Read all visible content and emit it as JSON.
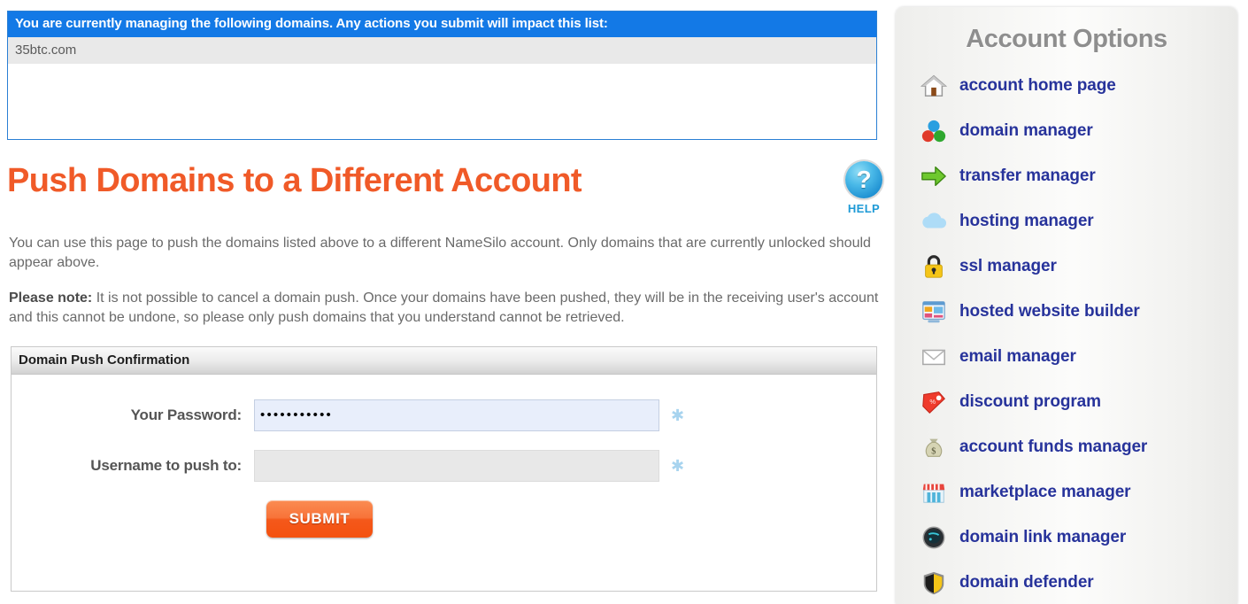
{
  "domains_panel": {
    "header": "You are currently managing the following domains. Any actions you submit will impact this list:",
    "domains": [
      "35btc.com"
    ]
  },
  "page": {
    "title": "Push Domains to a Different Account",
    "help_label": "HELP",
    "help_icon_glyph": "?",
    "intro_paragraph": "You can use this page to push the domains listed above to a different NameSilo account. Only domains that are currently unlocked should appear above.",
    "note_label": "Please note:",
    "note_text": " It is not possible to cancel a domain push. Once your domains have been pushed, they will be in the receiving user's account and this cannot be undone, so please only push domains that you understand cannot be retrieved."
  },
  "form": {
    "header": "Domain Push Confirmation",
    "fields": [
      {
        "label": "Your Password:",
        "value": "•••••••••••",
        "placeholder": "",
        "required_marker": "✱",
        "state": "focused"
      },
      {
        "label": "Username to push to:",
        "value": "",
        "placeholder": "",
        "required_marker": "✱",
        "state": "plain"
      }
    ],
    "submit_label": "SUBMIT"
  },
  "sidebar": {
    "title": "Account Options",
    "items": [
      {
        "label": "account home page",
        "icon": "house-icon"
      },
      {
        "label": "domain manager",
        "icon": "molecule-icon"
      },
      {
        "label": "transfer manager",
        "icon": "green-arrow-icon"
      },
      {
        "label": "hosting manager",
        "icon": "cloud-icon"
      },
      {
        "label": "ssl manager",
        "icon": "padlock-icon"
      },
      {
        "label": "hosted website builder",
        "icon": "website-builder-icon"
      },
      {
        "label": "email manager",
        "icon": "envelope-icon"
      },
      {
        "label": "discount program",
        "icon": "price-tag-icon"
      },
      {
        "label": "account funds manager",
        "icon": "money-bag-icon"
      },
      {
        "label": "marketplace manager",
        "icon": "storefront-icon"
      },
      {
        "label": "domain link manager",
        "icon": "globe-icon"
      },
      {
        "label": "domain defender",
        "icon": "shield-icon"
      }
    ]
  },
  "colors": {
    "header_blue": "#1379e6",
    "title_orange": "#f05a28",
    "link_blue": "#27339b",
    "submit_orange": "#f4581b",
    "help_blue": "#1e9ad6"
  }
}
